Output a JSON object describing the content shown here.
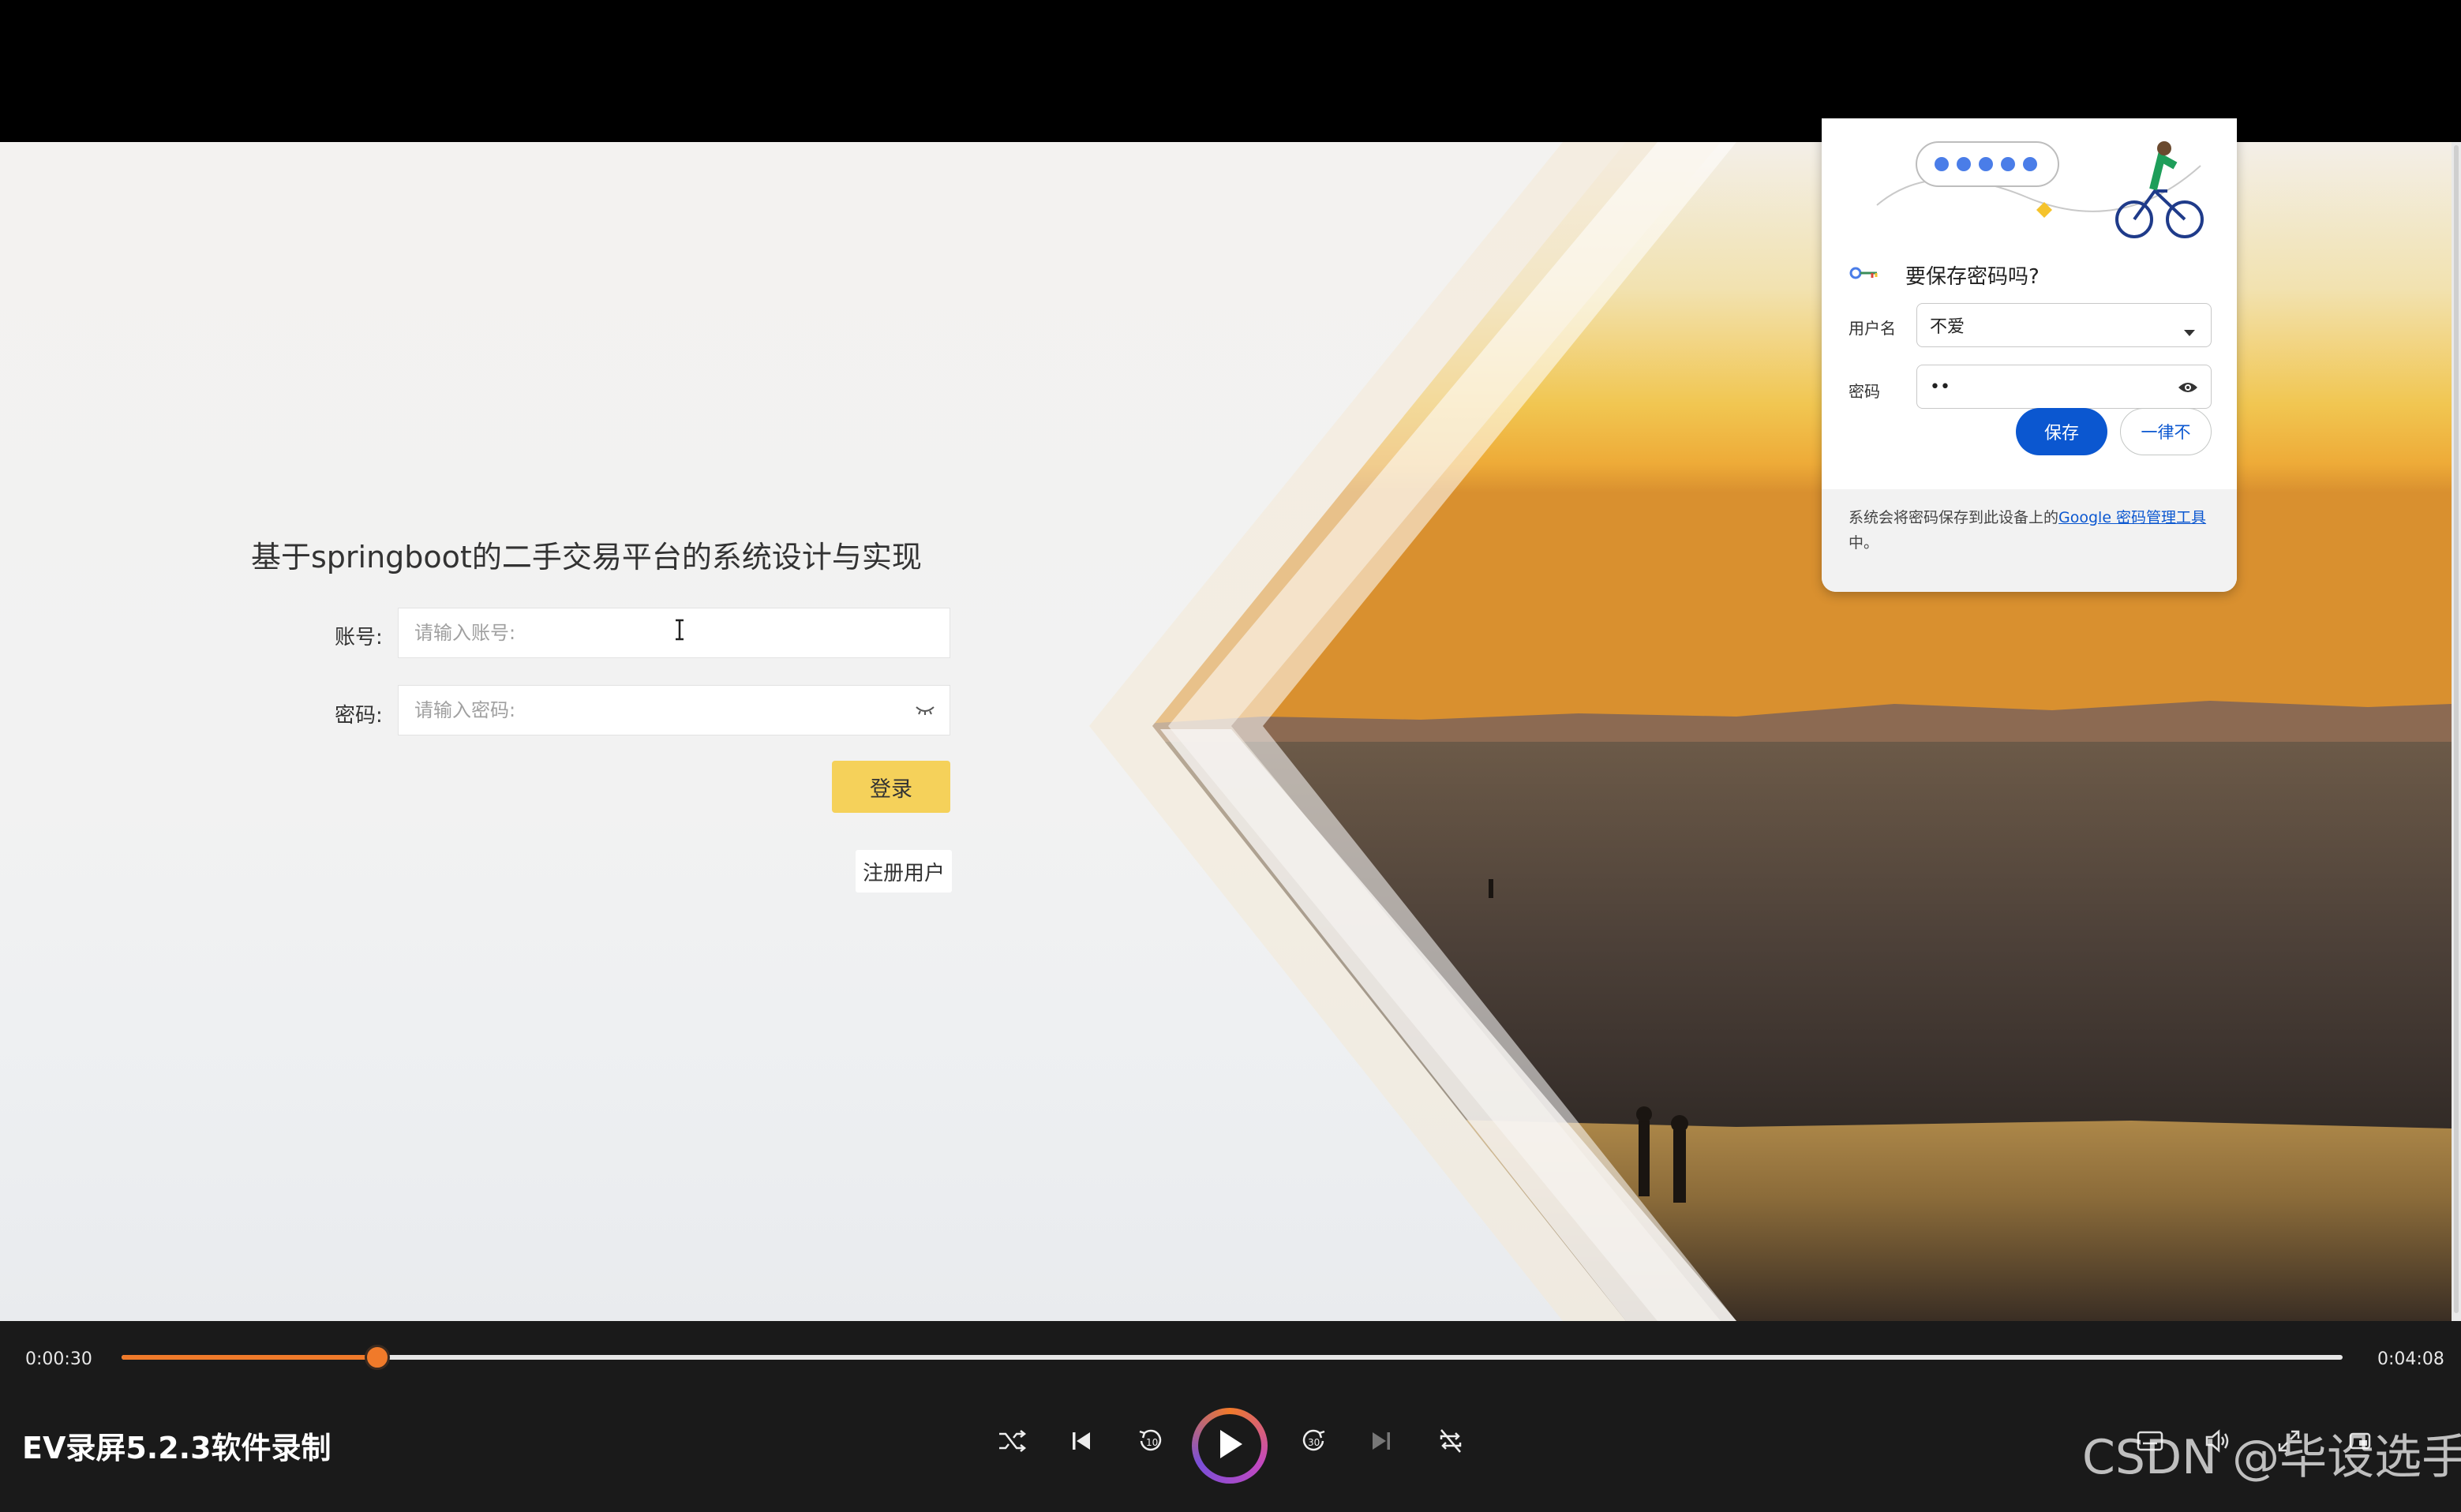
{
  "login": {
    "title": "基于springboot的二手交易平台的系统设计与实现",
    "account_label": "账号:",
    "account_placeholder": "请输入账号:",
    "password_label": "密码:",
    "password_placeholder": "请输入密码:",
    "login_button": "登录",
    "register_link": "注册用户"
  },
  "password_popup": {
    "title": "要保存密码吗?",
    "username_label": "用户名",
    "username_value": "不爱",
    "password_label": "密码",
    "password_value": "••",
    "save_button": "保存",
    "never_button": "一律不",
    "footer_text": "系统会将密码保存到此设备上的",
    "footer_link": "Google 密码管理工具",
    "footer_suffix": "中。"
  },
  "player": {
    "current_time": "0:00:30",
    "total_time": "0:04:08",
    "progress_fraction": 0.115,
    "app_title": "EV录屏5.2.3软件录制",
    "watermark": "CSDN @毕设选手"
  },
  "colors": {
    "accent_orange": "#f07a2a",
    "login_button": "#f5d15a",
    "popup_primary": "#0b57d0"
  }
}
